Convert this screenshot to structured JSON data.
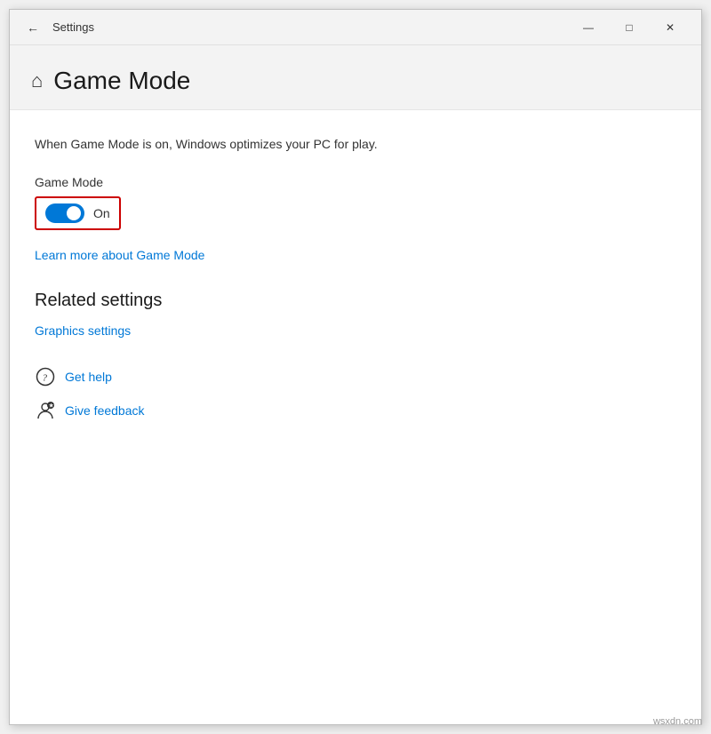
{
  "window": {
    "title": "Settings",
    "back_arrow": "←",
    "minimize": "—",
    "maximize": "□",
    "close": "✕"
  },
  "page": {
    "home_icon": "⌂",
    "title": "Game Mode",
    "description": "When Game Mode is on, Windows optimizes your PC for play.",
    "setting_label": "Game Mode",
    "toggle_state": "On",
    "learn_more_link": "Learn more about Game Mode"
  },
  "related_settings": {
    "title": "Related settings",
    "graphics_link": "Graphics settings"
  },
  "actions": {
    "get_help": "Get help",
    "give_feedback": "Give feedback"
  },
  "colors": {
    "toggle_on": "#0078d7",
    "link": "#0078d7",
    "red_border": "#cc0000"
  }
}
